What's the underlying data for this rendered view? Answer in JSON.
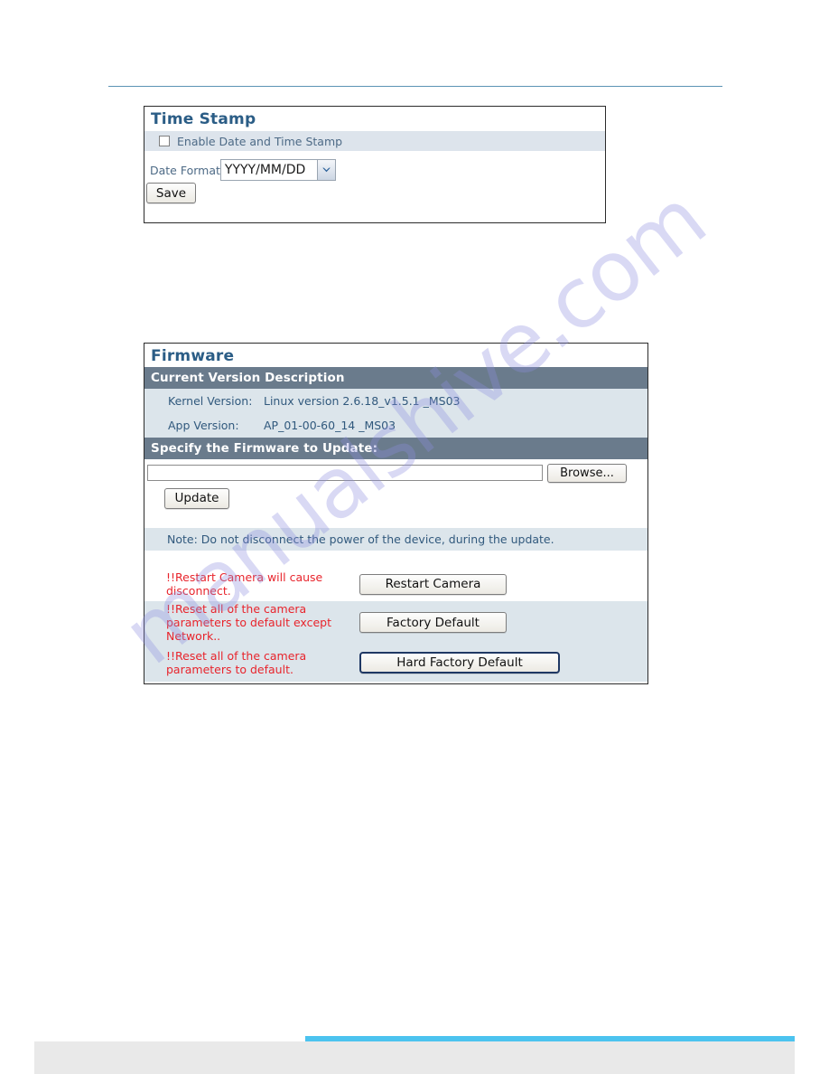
{
  "page": {
    "watermark_text": "manualshive.com"
  },
  "time_stamp_panel": {
    "title": "Time Stamp",
    "enable_checkbox_label": "Enable Date and Time Stamp",
    "enable_checked": false,
    "date_format_label": "Date Format",
    "date_format_value": "YYYY/MM/DD",
    "save_label": "Save"
  },
  "firmware_panel": {
    "title": "Firmware",
    "current_version_header": "Current Version Description",
    "rows": [
      {
        "key": "Kernel Version:",
        "value": "Linux version 2.6.18_v1.5.1 _MS03"
      },
      {
        "key": "App Version:",
        "value": "AP_01-00-60_14 _MS03"
      }
    ],
    "specify_header": "Specify the Firmware to Update:",
    "file_input_value": "",
    "browse_label": "Browse...",
    "update_label": "Update",
    "note": "Note: Do not disconnect the power of the device, during the update.",
    "actions": [
      {
        "warning_lines": [
          "!!Restart Camera will cause",
          "disconnect."
        ],
        "button_label": "Restart Camera"
      },
      {
        "warning_lines": [
          "!!Reset all of the camera",
          "parameters to default except",
          "Network.."
        ],
        "button_label": "Factory Default"
      },
      {
        "warning_lines": [
          "!!Reset all of the camera",
          "parameters to default."
        ],
        "button_label": "Hard Factory Default"
      }
    ]
  },
  "colors": {
    "panel_title": "#2b5d86",
    "section_header_bg": "#6a7b8c",
    "row_bg": "#dce5eb",
    "label_text": "#31597d",
    "warning_text": "#e8242c",
    "footer_blue": "#4cc3ef",
    "rule": "#5b94b5"
  }
}
